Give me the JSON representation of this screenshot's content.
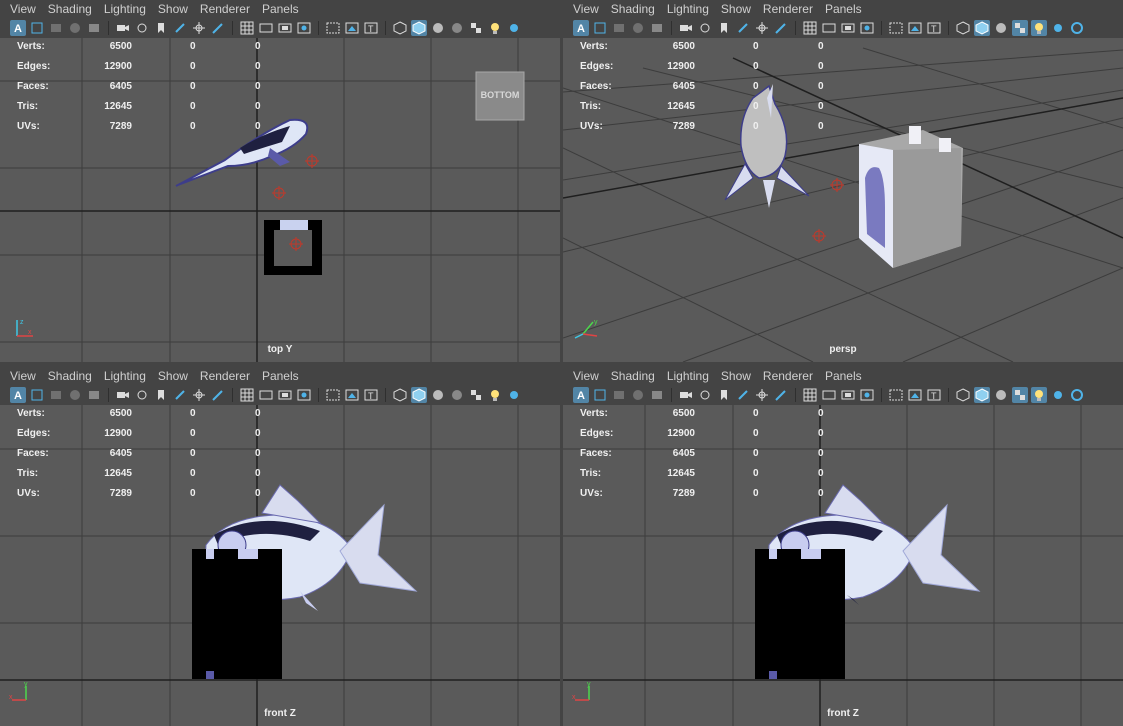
{
  "menus": [
    "View",
    "Shading",
    "Lighting",
    "Show",
    "Renderer",
    "Panels"
  ],
  "stats": [
    {
      "label": "Verts:",
      "value": "6500",
      "v2": "0",
      "v3": "0"
    },
    {
      "label": "Edges:",
      "value": "12900",
      "v2": "0",
      "v3": "0"
    },
    {
      "label": "Faces:",
      "value": "6405",
      "v2": "0",
      "v3": "0"
    },
    {
      "label": "Tris:",
      "value": "12645",
      "v2": "0",
      "v3": "0"
    },
    {
      "label": "UVs:",
      "value": "7289",
      "v2": "0",
      "v3": "0"
    }
  ],
  "viewports": {
    "top": {
      "camera": "top Y",
      "view_cube": "BOTTOM"
    },
    "persp": {
      "camera": "persp"
    },
    "front": {
      "camera": "front Z"
    },
    "side": {
      "camera": "front Z"
    }
  },
  "axes": {
    "x": "x",
    "y": "y",
    "z": "z"
  },
  "icons": [
    "select-camera-icon",
    "grid-toggle-icon",
    "camera-attributes-icon",
    "bookmark-icon",
    "image-plane-icon",
    "two-d-pan-zoom-icon",
    "grease-pencil-icon",
    "grid-icon",
    "film-gate-icon",
    "resolution-gate-icon",
    "gate-mask-icon",
    "field-chart-icon",
    "safe-action-icon",
    "safe-title-icon",
    "wireframe-icon",
    "smooth-shade-icon",
    "shade-wireframe-icon",
    "textured-icon",
    "lights-icon",
    "shadows-icon",
    "ambient-occlusion-icon"
  ],
  "colors": {
    "accent": "#5285a6",
    "viewport_bg": "#5a5a5a",
    "ui_bg": "#444444",
    "grid_line": "#3a3a3a",
    "grid_axis": "#1f1f1f",
    "model_light": "#cdd6f0",
    "model_dark": "#5a5aa8",
    "pivot": "#c0392b"
  }
}
